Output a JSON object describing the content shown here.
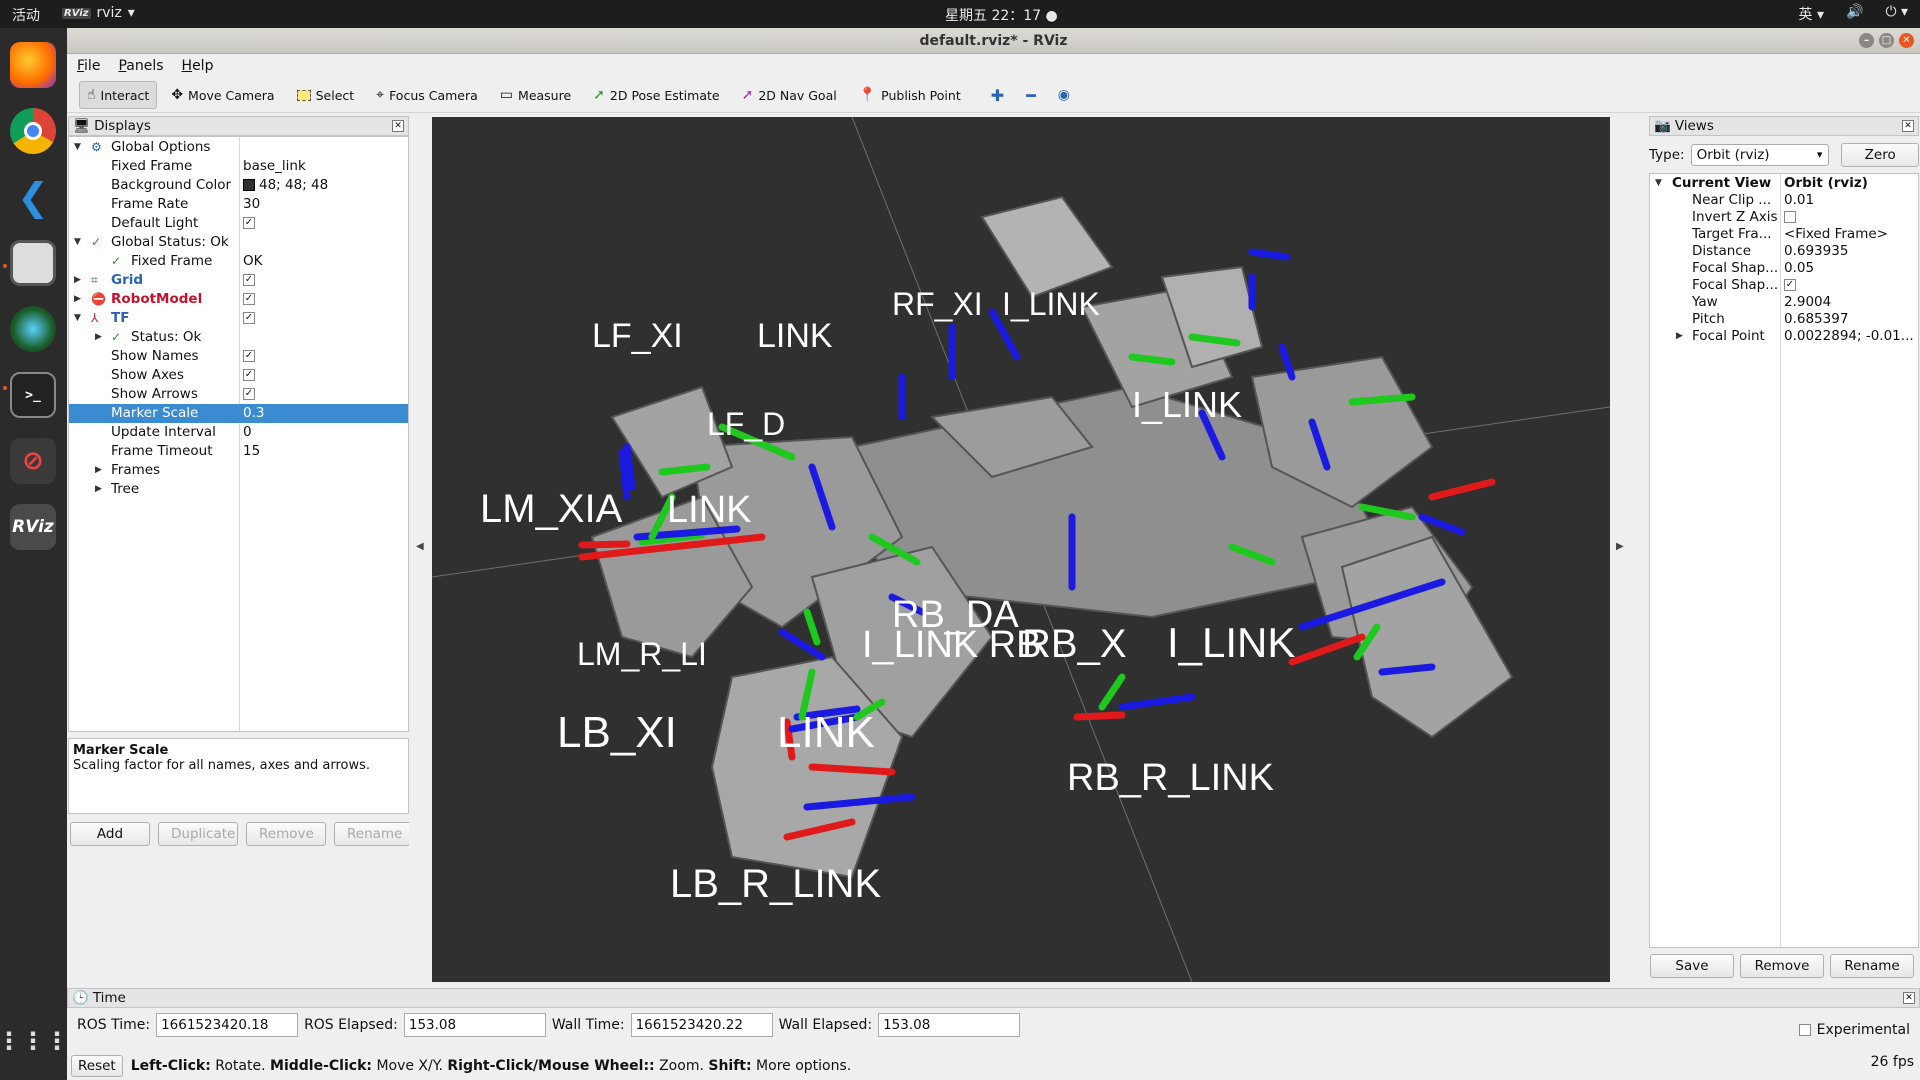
{
  "topbar": {
    "activities": "活动",
    "app_name": "rviz",
    "app_logo_text": "RViz",
    "clock": "星期五 22：17",
    "input_method": "英"
  },
  "window": {
    "title": "default.rviz* - RViz"
  },
  "menu": [
    "File",
    "Panels",
    "Help"
  ],
  "toolbar": {
    "interact": "Interact",
    "move_camera": "Move Camera",
    "select": "Select",
    "focus_camera": "Focus Camera",
    "measure": "Measure",
    "pose_estimate": "2D Pose Estimate",
    "nav_goal": "2D Nav Goal",
    "publish_point": "Publish Point"
  },
  "displays": {
    "title": "Displays",
    "global_options": "Global Options",
    "fixed_frame": "Fixed Frame",
    "fixed_frame_value": "base_link",
    "background_color": "Background Color",
    "background_color_value": "48; 48; 48",
    "frame_rate": "Frame Rate",
    "frame_rate_value": "30",
    "default_light": "Default Light",
    "global_status": "Global Status: Ok",
    "fixed_frame_status": "Fixed Frame",
    "fixed_frame_status_value": "OK",
    "grid": "Grid",
    "robot_model": "RobotModel",
    "tf": "TF",
    "tf_status": "Status: Ok",
    "show_names": "Show Names",
    "show_axes": "Show Axes",
    "show_arrows": "Show Arrows",
    "marker_scale": "Marker Scale",
    "marker_scale_value": "0.3",
    "update_interval": "Update Interval",
    "update_interval_value": "0",
    "frame_timeout": "Frame Timeout",
    "frame_timeout_value": "15",
    "frames": "Frames",
    "tree": "Tree",
    "desc_title": "Marker Scale",
    "desc_text": "Scaling factor for all names, axes and arrows.",
    "btn_add": "Add",
    "btn_duplicate": "Duplicate",
    "btn_remove": "Remove",
    "btn_rename": "Rename"
  },
  "viewport_labels": {
    "lf_xi": "LF_XI",
    "lf_link": "LINK",
    "rf": "RF_XI",
    "rf_link": "I_LINK",
    "lf_d": "LF_D",
    "lm_xia": "LM_XIA",
    "lm_link": "LINK",
    "rm_link": "I_LINK",
    "lm_r": "LM_R_LI",
    "lb_xi": "LB_XI",
    "lb_link": "LINK",
    "rb_da": "RB_DA",
    "rb_link": "I_LINK RB",
    "rb_xi": "RB_X",
    "rb_link2": "I_LINK",
    "rb_r": "RB_R_LINK",
    "lb_r": "LB_R_LINK"
  },
  "views": {
    "title": "Views",
    "type_label": "Type:",
    "type_value": "Orbit (rviz)",
    "zero": "Zero",
    "current_view": "Current View",
    "current_view_value": "Orbit (rviz)",
    "near_clip": "Near Clip ...",
    "near_clip_value": "0.01",
    "invert_z": "Invert Z Axis",
    "target_frame": "Target Fra...",
    "target_frame_value": "<Fixed Frame>",
    "distance": "Distance",
    "distance_value": "0.693935",
    "focal_shape1": "Focal Shap...",
    "focal_shape1_value": "0.05",
    "focal_shape2": "Focal Shap...",
    "yaw": "Yaw",
    "yaw_value": "2.9004",
    "pitch": "Pitch",
    "pitch_value": "0.685397",
    "focal_point": "Focal Point",
    "focal_point_value": "0.0022894; -0.01...",
    "btn_save": "Save",
    "btn_remove": "Remove",
    "btn_rename": "Rename"
  },
  "time": {
    "title": "Time",
    "ros_time_label": "ROS Time:",
    "ros_time": "1661523420.18",
    "ros_elapsed_label": "ROS Elapsed:",
    "ros_elapsed": "153.08",
    "wall_time_label": "Wall Time:",
    "wall_time": "1661523420.22",
    "wall_elapsed_label": "Wall Elapsed:",
    "wall_elapsed": "153.08",
    "experimental": "Experimental"
  },
  "status": {
    "reset": "Reset",
    "left_click": "Left-Click:",
    "left_click_text": "Rotate.",
    "middle_click": "Middle-Click:",
    "middle_click_text": "Move X/Y.",
    "right_click": "Right-Click/Mouse Wheel::",
    "right_click_text": "Zoom.",
    "shift": "Shift:",
    "shift_text": "More options.",
    "fps": "26 fps"
  }
}
